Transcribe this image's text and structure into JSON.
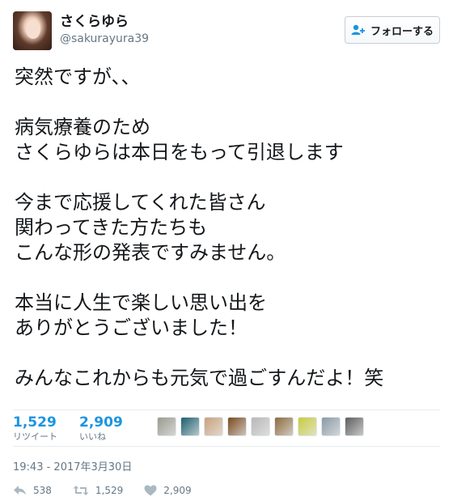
{
  "user": {
    "display_name": "さくらゆら",
    "screen_name": "@sakurayura39"
  },
  "follow_button": {
    "label": "フォローする",
    "icon": "follow-user-plus-icon"
  },
  "tweet": {
    "paragraphs": [
      [
        "突然ですが、、"
      ],
      [
        "病気療養のため",
        "さくらゆらは本日をもって引退します"
      ],
      [
        "今まで応援してくれた皆さん",
        "関わってきた方たちも",
        "こんな形の発表ですみません。"
      ],
      [
        "本当に人生で楽しい思い出を",
        "ありがとうございました！"
      ],
      [
        "みんなこれからも元気で過ごすんだよ！笑"
      ]
    ]
  },
  "stats": {
    "retweets": {
      "count": "1,529",
      "label": "リツイート"
    },
    "likes": {
      "count": "2,909",
      "label": "いいね"
    }
  },
  "likers": [
    {
      "name": "liker-avatar-1",
      "color": "#9a9a8f"
    },
    {
      "name": "liker-avatar-2",
      "color": "#1a5f6e"
    },
    {
      "name": "liker-avatar-3",
      "color": "#c9a27c"
    },
    {
      "name": "liker-avatar-4",
      "color": "#7a4a1e"
    },
    {
      "name": "liker-avatar-5",
      "color": "#b8b8b8"
    },
    {
      "name": "liker-avatar-6",
      "color": "#8c6a3c"
    },
    {
      "name": "liker-avatar-7",
      "color": "#c7cc3d"
    },
    {
      "name": "liker-avatar-8",
      "color": "#8a9ba6"
    },
    {
      "name": "liker-avatar-9",
      "color": "#5d5d5d"
    }
  ],
  "timestamp": "19:43 - 2017年3月30日",
  "actions": {
    "reply": {
      "count": "538",
      "icon": "reply-icon"
    },
    "retweet": {
      "count": "1,529",
      "icon": "retweet-icon"
    },
    "like": {
      "count": "2,909",
      "icon": "heart-icon"
    }
  },
  "colors": {
    "link_blue": "#1b95e0",
    "muted_gray": "#657786",
    "text": "#14171a"
  }
}
